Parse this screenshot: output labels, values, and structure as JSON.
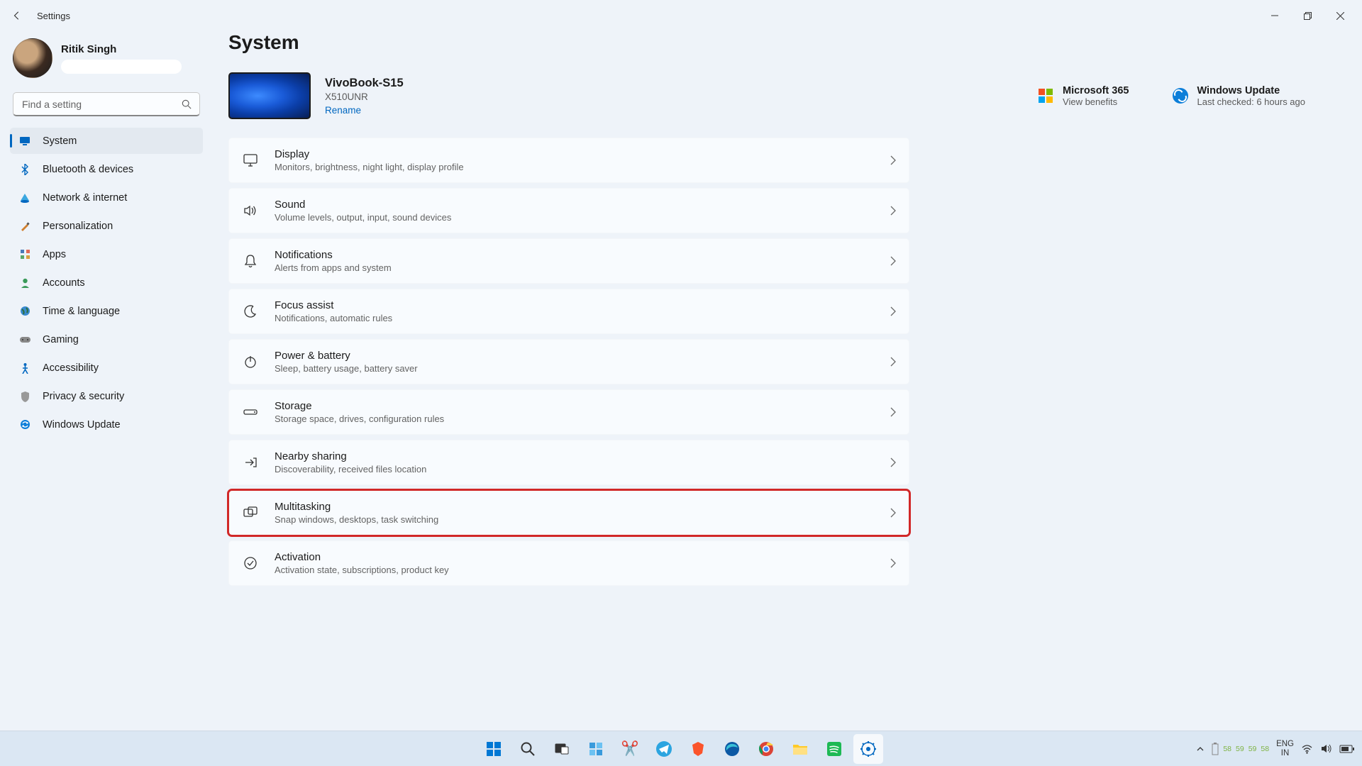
{
  "app_title": "Settings",
  "page_title": "System",
  "user": {
    "name": "Ritik Singh"
  },
  "search": {
    "placeholder": "Find a setting"
  },
  "nav": [
    {
      "label": "System",
      "icon": "🖥️",
      "active": true
    },
    {
      "label": "Bluetooth & devices",
      "icon": "bt"
    },
    {
      "label": "Network & internet",
      "icon": "🌐"
    },
    {
      "label": "Personalization",
      "icon": "🖌️"
    },
    {
      "label": "Apps",
      "icon": "▦"
    },
    {
      "label": "Accounts",
      "icon": "👤"
    },
    {
      "label": "Time & language",
      "icon": "🌍"
    },
    {
      "label": "Gaming",
      "icon": "🎮"
    },
    {
      "label": "Accessibility",
      "icon": "♿"
    },
    {
      "label": "Privacy & security",
      "icon": "🛡️"
    },
    {
      "label": "Windows Update",
      "icon": "🔄"
    }
  ],
  "device": {
    "name": "VivoBook-S15",
    "model": "X510UNR",
    "rename": "Rename"
  },
  "info_blocks": {
    "ms365": {
      "title": "Microsoft 365",
      "sub": "View benefits"
    },
    "wu": {
      "title": "Windows Update",
      "sub": "Last checked: 6 hours ago"
    }
  },
  "settings": [
    {
      "id": "display",
      "title": "Display",
      "sub": "Monitors, brightness, night light, display profile",
      "icon": "monitor"
    },
    {
      "id": "sound",
      "title": "Sound",
      "sub": "Volume levels, output, input, sound devices",
      "icon": "sound"
    },
    {
      "id": "notifications",
      "title": "Notifications",
      "sub": "Alerts from apps and system",
      "icon": "bell"
    },
    {
      "id": "focus-assist",
      "title": "Focus assist",
      "sub": "Notifications, automatic rules",
      "icon": "moon"
    },
    {
      "id": "power-battery",
      "title": "Power & battery",
      "sub": "Sleep, battery usage, battery saver",
      "icon": "power"
    },
    {
      "id": "storage",
      "title": "Storage",
      "sub": "Storage space, drives, configuration rules",
      "icon": "storage"
    },
    {
      "id": "nearby-sharing",
      "title": "Nearby sharing",
      "sub": "Discoverability, received files location",
      "icon": "share"
    },
    {
      "id": "multitasking",
      "title": "Multitasking",
      "sub": "Snap windows, desktops, task switching",
      "icon": "multitask",
      "highlighted": true
    },
    {
      "id": "activation",
      "title": "Activation",
      "sub": "Activation state, subscriptions, product key",
      "icon": "check"
    }
  ],
  "taskbar": {
    "lang1": "ENG",
    "lang2": "IN",
    "stats": [
      "58",
      "59",
      "59",
      "58"
    ]
  }
}
